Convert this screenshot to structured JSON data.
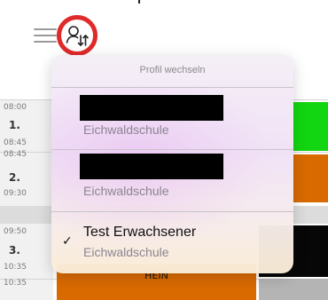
{
  "header": {
    "menu_icon": "hamburger-menu-icon",
    "profile_switch_icon": "switch-user-icon",
    "highlight_color": "#e02a2a"
  },
  "timetable": {
    "slots": [
      {
        "start": "08:00",
        "number": "1.",
        "end": "08:45"
      },
      {
        "start": "08:45",
        "number": "2.",
        "end": "09:30"
      },
      {
        "start": "09:50",
        "number": "3.",
        "end": "10:35"
      },
      {
        "start": "10:35"
      }
    ],
    "visible_lesson_label": "HEIN",
    "colors": {
      "green": "#11d611",
      "orange": "#d86a00",
      "black": "#070707",
      "gray": "#b4b4b4"
    }
  },
  "popover": {
    "title": "Profil wechseln",
    "profiles": [
      {
        "name_redacted": true,
        "school": "Eichwaldschule",
        "selected": false
      },
      {
        "name_redacted": true,
        "school": "Eichwaldschule",
        "selected": false
      },
      {
        "name": "Test Erwachsener",
        "school": "Eichwaldschule",
        "selected": true,
        "check_glyph": "✓"
      }
    ]
  }
}
